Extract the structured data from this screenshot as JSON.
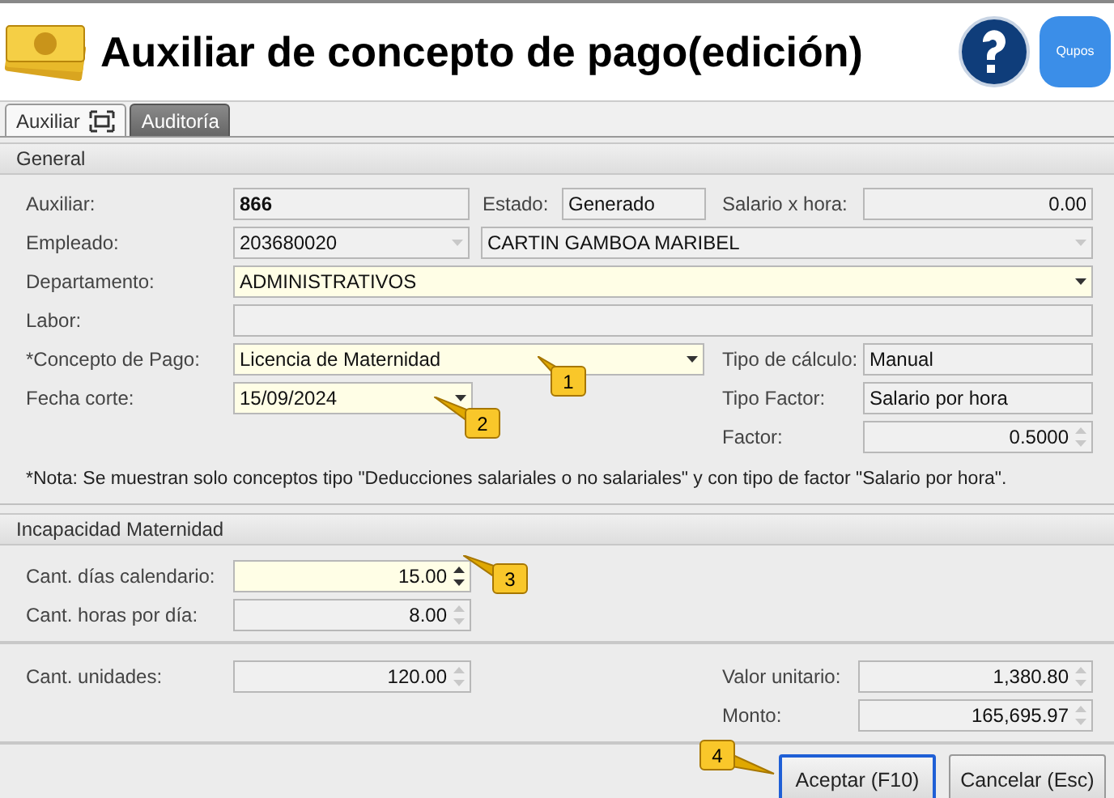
{
  "window": {
    "title": "Auxiliar de concepto de pago(edición)",
    "logo_text": "Qupos"
  },
  "tabs": [
    {
      "label": "Auxiliar",
      "selected": true
    },
    {
      "label": "Auditoría",
      "selected": false
    }
  ],
  "general": {
    "title": "General",
    "auxiliar": {
      "label": "Auxiliar:",
      "value": "866",
      "kind": "text",
      "editable": false,
      "emphasis": true
    },
    "estado": {
      "label": "Estado:",
      "value": "Generado",
      "kind": "text",
      "editable": false
    },
    "salario_hora": {
      "label": "Salario x hora:",
      "value": "0.00",
      "kind": "number",
      "editable": false
    },
    "empleado": {
      "label": "Empleado:",
      "value": "203680020",
      "kind": "combo",
      "editable": false
    },
    "empleado_nombre": {
      "value": "CARTIN GAMBOA MARIBEL",
      "kind": "combo",
      "editable": false
    },
    "departamento": {
      "label": "Departamento:",
      "value": "ADMINISTRATIVOS",
      "kind": "combo",
      "editable": true
    },
    "labor": {
      "label": "Labor:",
      "kind": "text",
      "editable": false
    },
    "concepto": {
      "label": "*Concepto de Pago:",
      "value": "Licencia de Maternidad",
      "kind": "combo",
      "editable": true
    },
    "tipo_calculo": {
      "label": "Tipo de cálculo:",
      "value": "Manual",
      "kind": "text",
      "editable": false
    },
    "fecha_corte": {
      "label": "Fecha corte:",
      "value": "15/09/2024",
      "kind": "combo",
      "editable": true
    },
    "tipo_factor": {
      "label": "Tipo Factor:",
      "value": "Salario por hora",
      "kind": "text",
      "editable": false
    },
    "factor": {
      "label": "Factor:",
      "value": "0.5000",
      "kind": "spin",
      "editable": false
    },
    "note": "*Nota: Se muestran solo conceptos tipo \"Deducciones salariales o no salariales\" y con tipo de factor \"Salario por hora\"."
  },
  "incapacidad": {
    "title": "Incapacidad Maternidad",
    "dias": {
      "label": "Cant. días calendario:",
      "value": "15.00",
      "kind": "spin",
      "editable": true
    },
    "horas": {
      "label": "Cant. horas por día:",
      "value": "8.00",
      "kind": "spin",
      "editable": false
    }
  },
  "totales": {
    "unidades": {
      "label": "Cant. unidades:",
      "value": "120.00",
      "kind": "spin",
      "editable": false
    },
    "valor_unitario": {
      "label": "Valor unitario:",
      "value": "1,380.80",
      "kind": "spin",
      "editable": false
    },
    "monto": {
      "label": "Monto:",
      "value": "165,695.97",
      "kind": "spin",
      "editable": false
    }
  },
  "buttons": [
    {
      "label": "Aceptar (F10)",
      "focused": true
    },
    {
      "label": "Cancelar (Esc)",
      "focused": false
    }
  ],
  "callouts": [
    {
      "label": "1"
    },
    {
      "label": "2"
    },
    {
      "label": "3"
    },
    {
      "label": "4"
    }
  ]
}
